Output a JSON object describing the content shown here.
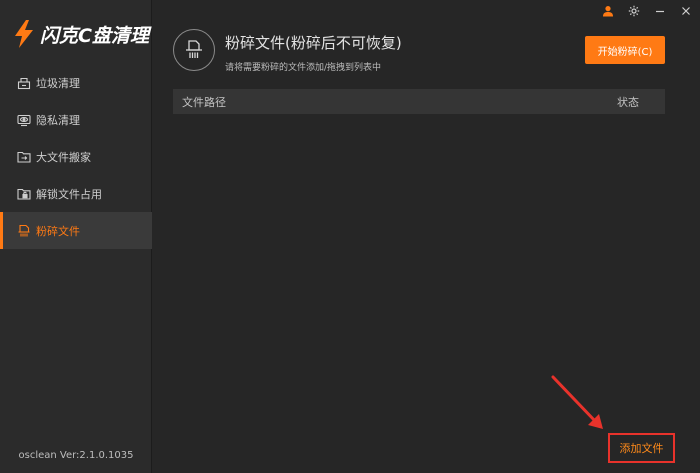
{
  "app": {
    "name": "闪克C盘清理",
    "version": "osclean Ver:2.1.0.1035",
    "accent_color": "#ff7a14"
  },
  "titlebar": {
    "icons": [
      "user-icon",
      "gear-icon",
      "minimize-icon",
      "close-icon"
    ]
  },
  "sidebar": {
    "items": [
      {
        "label": "垃圾清理",
        "icon": "broom-icon",
        "active": false
      },
      {
        "label": "隐私清理",
        "icon": "eye-icon",
        "active": false
      },
      {
        "label": "大文件搬家",
        "icon": "folder-move-icon",
        "active": false
      },
      {
        "label": "解锁文件占用",
        "icon": "unlock-file-icon",
        "active": false
      },
      {
        "label": "粉碎文件",
        "icon": "shred-file-icon",
        "active": true
      }
    ]
  },
  "header": {
    "title": "粉碎文件(粉碎后不可恢复)",
    "subtitle": "请将需要粉碎的文件添加/拖拽到列表中",
    "start_button": "开始粉碎(C)"
  },
  "table": {
    "columns": [
      "文件路径",
      "状态"
    ],
    "rows": []
  },
  "footer": {
    "add_file_button": "添加文件"
  }
}
